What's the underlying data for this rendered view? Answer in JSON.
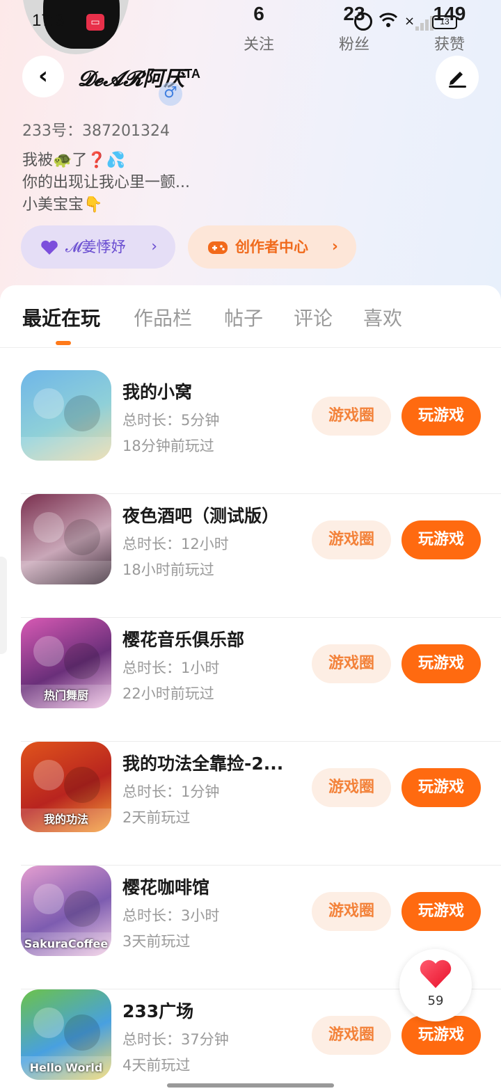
{
  "status_bar": {
    "time": "17:3",
    "battery": "13"
  },
  "profile": {
    "stats": [
      {
        "num": "6",
        "label": "关注"
      },
      {
        "num": "23",
        "label": "粉丝"
      },
      {
        "num": "149",
        "label": "获赞"
      }
    ],
    "username": "𝓓𝓮𝓐𝓡阿厌",
    "username_sup": "TA",
    "gender": "♂",
    "uid": "233号：387201324",
    "bio": [
      "我被🐢了❓💦",
      "你的出现让我心里一颤...",
      "小美宝宝👇"
    ],
    "tag_pill": "𝓜姜悸妤",
    "creator_pill": "创作者中心"
  },
  "tabs": [
    "最近在玩",
    "作品栏",
    "帖子",
    "评论",
    "喜欢"
  ],
  "games": [
    {
      "title": "我的小窝",
      "duration": "总时长：5分钟",
      "last_played": "18分钟前玩过",
      "circle": "游戏圈",
      "play": "玩游戏",
      "colors": [
        "#6fb6e8",
        "#8fd0d8",
        "#e9d9a8"
      ]
    },
    {
      "title": "夜色酒吧（测试版）",
      "duration": "总时长：12小时",
      "last_played": "18小时前玩过",
      "circle": "游戏圈",
      "play": "玩游戏",
      "colors": [
        "#7a2f4e",
        "#c9a7b8",
        "#3a2a36"
      ]
    },
    {
      "title": "樱花音乐俱乐部",
      "duration": "总时长：1小时",
      "last_played": "22小时前玩过",
      "circle": "游戏圈",
      "play": "玩游戏",
      "colors": [
        "#d85ab4",
        "#6a2f7a",
        "#f2c5e6"
      ]
    },
    {
      "title": "我的功法全靠捡-2...",
      "duration": "总时长：1分钟",
      "last_played": "2天前玩过",
      "circle": "游戏圈",
      "play": "玩游戏",
      "colors": [
        "#e0541c",
        "#b8241f",
        "#f6a23b"
      ]
    },
    {
      "title": "樱花咖啡馆",
      "duration": "总时长：3小时",
      "last_played": "3天前玩过",
      "circle": "游戏圈",
      "play": "玩游戏",
      "colors": [
        "#e49ed0",
        "#7d5cb0",
        "#f4d0e6"
      ]
    },
    {
      "title": "233广场",
      "duration": "总时长：37分钟",
      "last_played": "4天前玩过",
      "circle": "游戏圈",
      "play": "玩游戏",
      "colors": [
        "#6cc24a",
        "#48a0e0",
        "#f2d86a"
      ]
    }
  ],
  "game_icon_texts": [
    "",
    "",
    "热门舞厨",
    "我的功法",
    "SakuraCoffee",
    "Hello World"
  ],
  "like_count": "59"
}
